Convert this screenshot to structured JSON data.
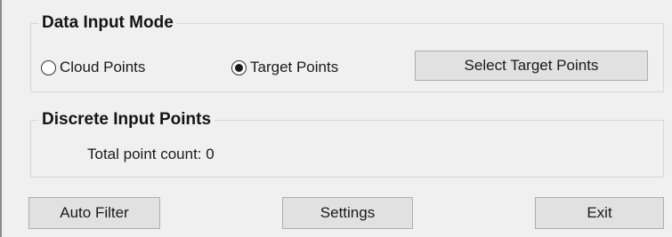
{
  "data_input_mode": {
    "title": "Data Input Mode",
    "options": [
      {
        "label": "Cloud Points",
        "selected": false
      },
      {
        "label": "Target Points",
        "selected": true
      }
    ],
    "select_button_label": "Select Target Points"
  },
  "discrete_input_points": {
    "title": "Discrete Input Points",
    "total_count_text": "Total point count: 0"
  },
  "footer": {
    "auto_filter_label": "Auto Filter",
    "settings_label": "Settings",
    "exit_label": "Exit"
  }
}
